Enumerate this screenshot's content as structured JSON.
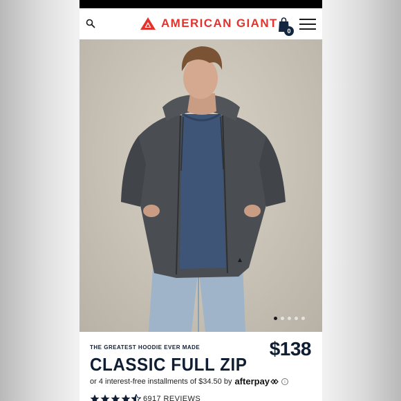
{
  "header": {
    "brand": "AMERICAN GIANT",
    "cart_count": "0",
    "icons": {
      "search": "search-icon",
      "bag": "shopping-bag-icon",
      "menu": "hamburger-menu-icon"
    }
  },
  "gallery": {
    "slide_count": 5,
    "active_slide": 1
  },
  "product": {
    "eyebrow": "THE GREATEST HOODIE EVER MADE",
    "title": "CLASSIC FULL ZIP",
    "price": "$138",
    "installments_text": "or 4 interest-free installments of $34.50 by",
    "afterpay_brand": "afterpay",
    "rating": 4.5,
    "reviews": "6917 REVIEWS"
  },
  "colors": {
    "brand_red": "#e2342c",
    "navy": "#0f1e33"
  }
}
